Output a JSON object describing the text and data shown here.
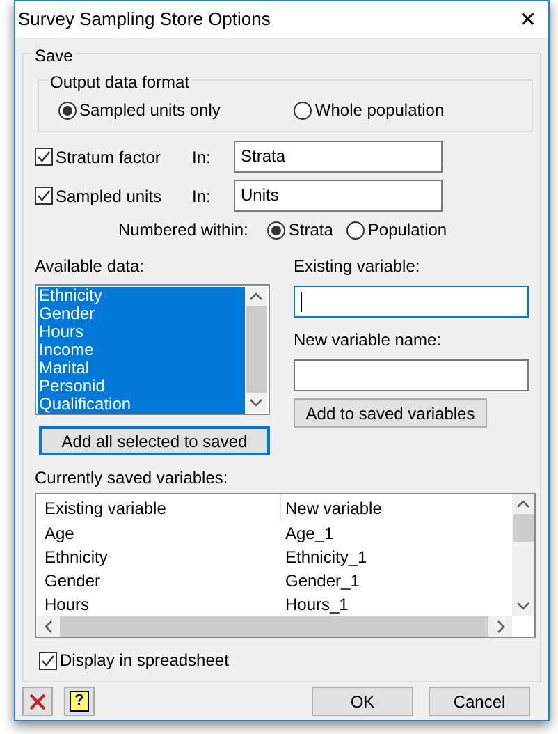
{
  "window": {
    "title": "Survey Sampling Store Options",
    "close": "✕"
  },
  "save_group": {
    "title": "Save",
    "output_format": {
      "title": "Output data format",
      "options": [
        {
          "label": "Sampled units only",
          "selected": true
        },
        {
          "label": "Whole population",
          "selected": false
        }
      ]
    },
    "stratum_factor": {
      "label": "Stratum factor",
      "checked": true,
      "in_label": "In:",
      "value": "Strata"
    },
    "sampled_units": {
      "label": "Sampled units",
      "checked": true,
      "in_label": "In:",
      "value": "Units"
    },
    "numbered_within": {
      "label": "Numbered within:",
      "options": [
        {
          "label": "Strata",
          "selected": true
        },
        {
          "label": "Population",
          "selected": false
        }
      ]
    },
    "available_data": {
      "label": "Available data:",
      "items": [
        {
          "label": "Ethnicity",
          "selected": true
        },
        {
          "label": "Gender",
          "selected": true
        },
        {
          "label": "Hours",
          "selected": true
        },
        {
          "label": "Income",
          "selected": true
        },
        {
          "label": "Marital",
          "selected": true
        },
        {
          "label": "Personid",
          "selected": true
        },
        {
          "label": "Qualification",
          "selected": true
        }
      ]
    },
    "existing_variable": {
      "label": "Existing variable:"
    },
    "new_variable_name": {
      "label": "New variable name:"
    },
    "add_to_saved_button": "Add to saved variables",
    "add_all_button": "Add all selected to saved",
    "saved_variables": {
      "label": "Currently saved variables:",
      "columns": [
        "Existing variable",
        "New variable"
      ],
      "rows": [
        [
          "Age",
          "Age_1"
        ],
        [
          "Ethnicity",
          "Ethnicity_1"
        ],
        [
          "Gender",
          "Gender_1"
        ],
        [
          "Hours",
          "Hours_1"
        ]
      ]
    },
    "display_in_spreadsheet": {
      "label": "Display in spreadsheet",
      "checked": true
    }
  },
  "buttons": [
    "OK",
    "Cancel"
  ],
  "help_button": "?"
}
